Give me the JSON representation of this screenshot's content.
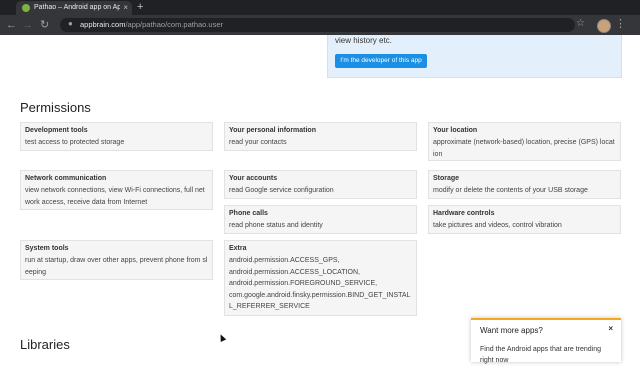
{
  "browser": {
    "tab_title": "Pathao – Android app on AppBr",
    "tab_close": "×",
    "new_tab": "+",
    "url_host": "appbrain.com",
    "url_path": "/app/pathao/com.pathao.user",
    "back": "←",
    "forward": "→",
    "reload": "↻",
    "lock": "🔒",
    "star": "☆",
    "menu": "⋮"
  },
  "developer_box": {
    "text": "view history etc.",
    "button": "I'm the developer of this app",
    "button_color": "#1a8fe3"
  },
  "permissions": {
    "heading": "Permissions",
    "cards": [
      {
        "title": "Development tools",
        "desc": "test access to protected storage"
      },
      {
        "title": "Your personal information",
        "desc": "read your contacts"
      },
      {
        "title": "Your location",
        "desc": "approximate (network-based) location, precise (GPS) location"
      },
      {
        "title": "Network communication",
        "desc": "view network connections, view Wi-Fi connections, full network access, receive data from Internet"
      },
      {
        "title": "Your accounts",
        "desc": "read Google service configuration"
      },
      {
        "title": "Storage",
        "desc": "modify or delete the contents of your USB storage"
      },
      {
        "title": "Phone calls",
        "desc": "read phone status and identity"
      },
      {
        "title": "Hardware controls",
        "desc": "take pictures and videos, control vibration"
      },
      {
        "title": "System tools",
        "desc": "run at startup, draw over other apps, prevent phone from sleeping"
      },
      {
        "title": "Extra",
        "desc": "android.permission.ACCESS_GPS,\nandroid.permission.ACCESS_LOCATION,\nandroid.permission.FOREGROUND_SERVICE,\ncom.google.android.finsky.permission.BIND_GET_INSTALL_REFERRER_SERVICE"
      }
    ]
  },
  "libraries": {
    "heading": "Libraries"
  },
  "popup": {
    "title": "Want more apps?",
    "close": "×",
    "desc": "Find the Android apps that are trending right now",
    "accent": "#f4a81d"
  }
}
